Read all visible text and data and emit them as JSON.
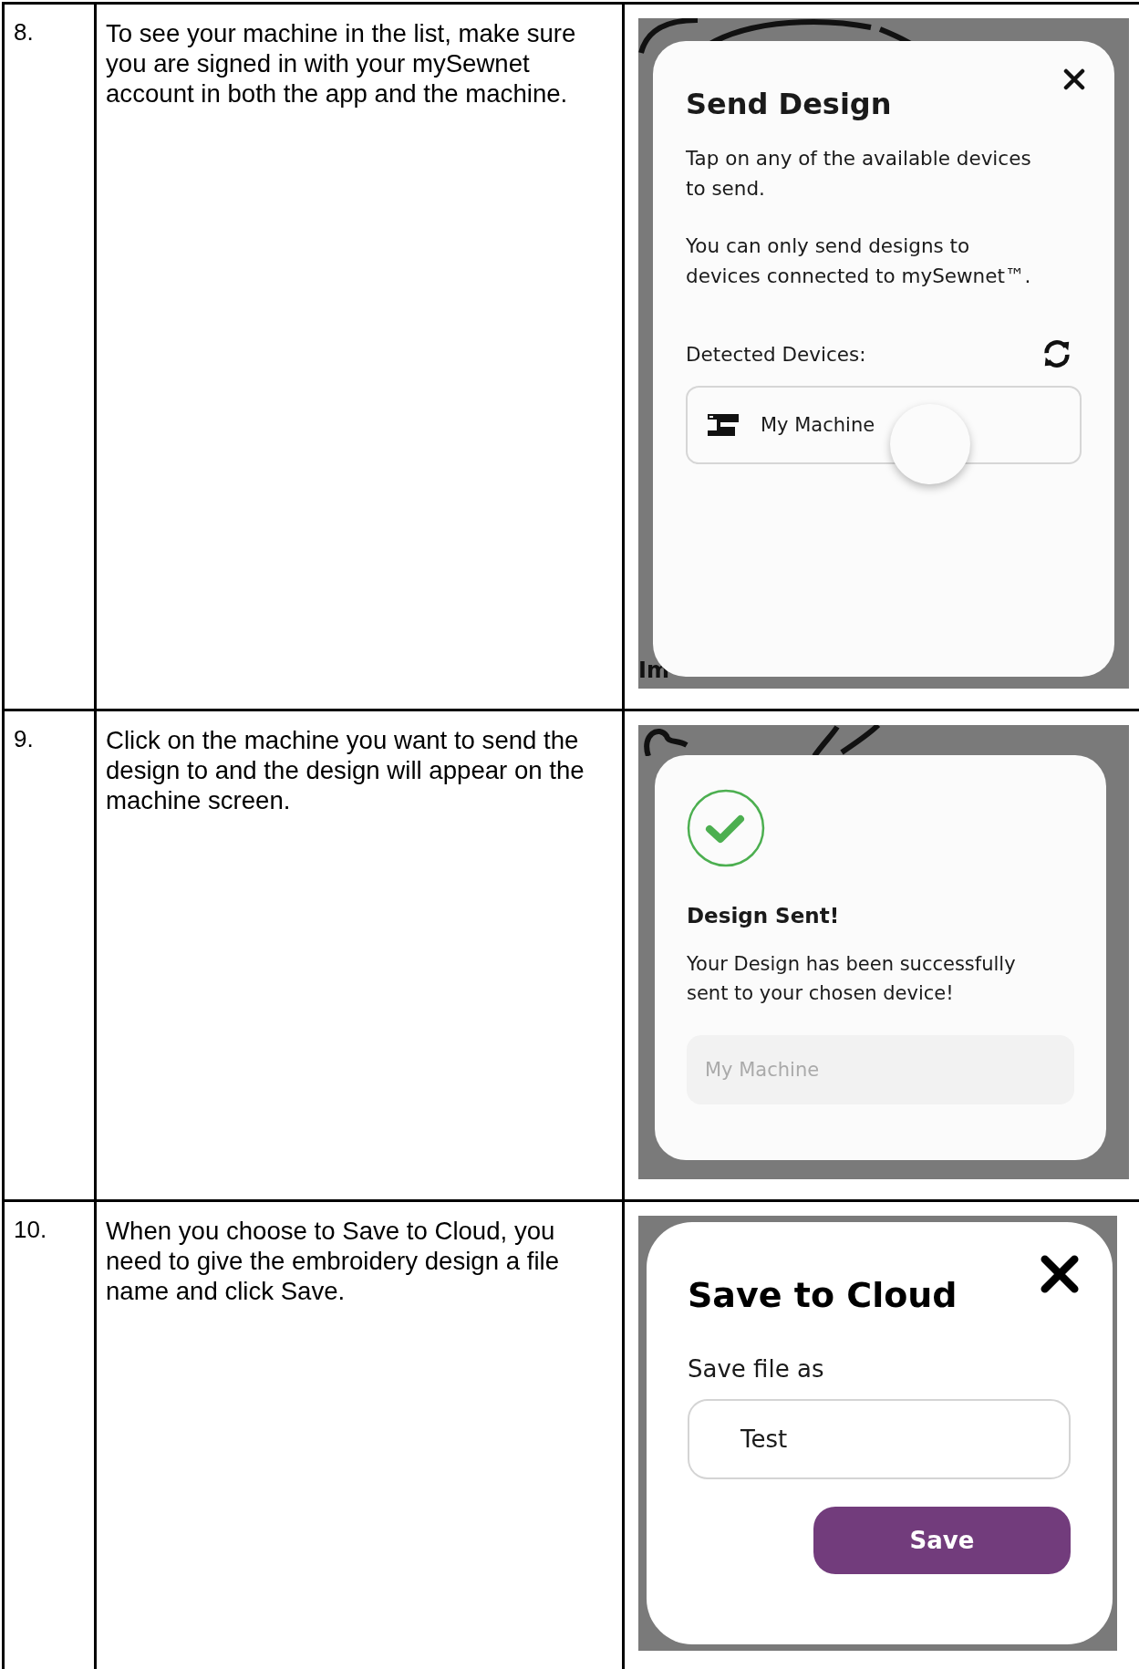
{
  "steps": [
    {
      "number": "8.",
      "text": "To see your machine in the list, make sure you are signed in with your mySewnet account in both the app and the machine.",
      "screenshot": {
        "kind": "send_design",
        "background_text": "Im",
        "title": "Send Design",
        "paragraphs": [
          "Tap on any of the available devices to send.",
          "You can only send designs to devices connected to mySewnet™."
        ],
        "devices_label": "Detected Devices:",
        "devices": [
          {
            "name": "My Machine",
            "touched": true
          }
        ]
      }
    },
    {
      "number": "9.",
      "text": "Click on the machine you want to send the design to and the design will appear on the machine screen.",
      "screenshot": {
        "kind": "design_sent",
        "title": "Design Sent!",
        "message": "Your Design has been successfully sent to your chosen device!",
        "device": "My Machine"
      }
    },
    {
      "number": "10.",
      "text": "When you choose to Save to Cloud, you need to give the embroidery design a file name and click Save.",
      "screenshot": {
        "kind": "save_to_cloud",
        "title": "Save to Cloud",
        "field_label": "Save file as",
        "field_value": "Test",
        "button": "Save"
      }
    }
  ]
}
